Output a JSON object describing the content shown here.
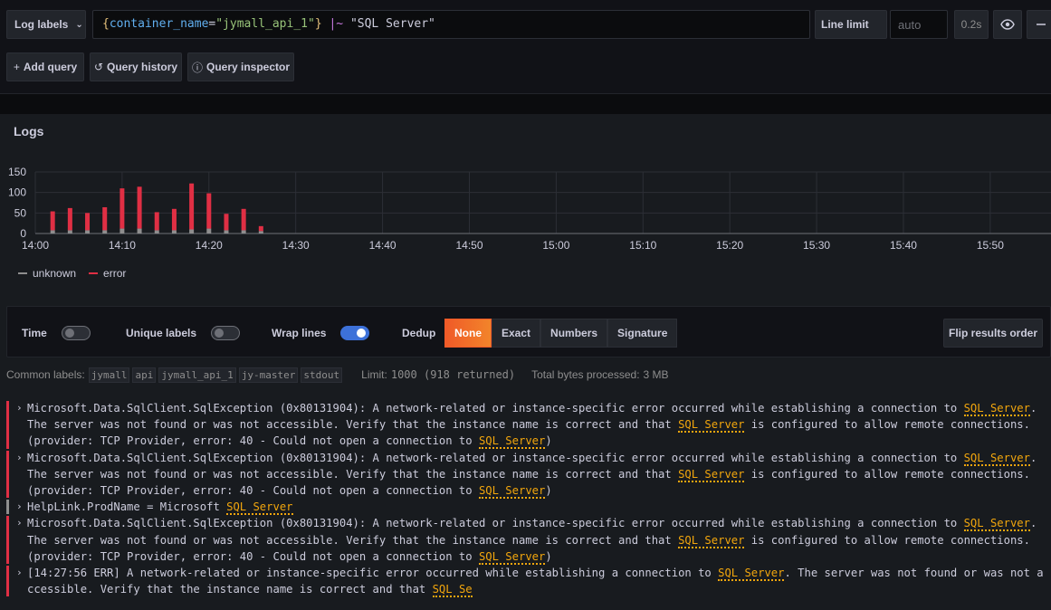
{
  "query_editor": {
    "labels_button": "Log labels",
    "query_parts": {
      "open_brace": "{",
      "key": "container_name",
      "equals": "=",
      "value": "\"jymall_api_1\"",
      "close_brace": "}",
      "pipe_op": " |~ ",
      "filter": "\"SQL Server\""
    },
    "line_limit_label": "Line limit",
    "line_limit_placeholder": "auto",
    "query_time": "0.2s"
  },
  "query_actions": {
    "add_query": "Add query",
    "query_history": "Query history",
    "query_inspector": "Query inspector"
  },
  "panel": {
    "title": "Logs"
  },
  "chart_data": {
    "type": "bar",
    "stacked": true,
    "x": [
      "14:02",
      "14:04",
      "14:06",
      "14:08",
      "14:10",
      "14:12",
      "14:14",
      "14:16",
      "14:18",
      "14:20",
      "14:22",
      "14:24",
      "14:26"
    ],
    "series": [
      {
        "name": "unknown",
        "color": "#8e8e8e",
        "values": [
          8,
          8,
          8,
          8,
          12,
          12,
          8,
          8,
          10,
          12,
          8,
          8,
          6
        ]
      },
      {
        "name": "error",
        "color": "#e02f44",
        "values": [
          46,
          54,
          42,
          56,
          98,
          102,
          44,
          52,
          112,
          86,
          40,
          52,
          12
        ]
      }
    ],
    "x_ticks": [
      "14:00",
      "14:10",
      "14:20",
      "14:30",
      "14:40",
      "14:50",
      "15:00",
      "15:10",
      "15:20",
      "15:30",
      "15:40",
      "15:50"
    ],
    "y_ticks": [
      "0",
      "50",
      "100",
      "150"
    ],
    "ylim": [
      0,
      150
    ],
    "xlim": [
      "14:00",
      "15:57"
    ],
    "grid": true,
    "legend": "bottom-left"
  },
  "legend": {
    "unknown": "unknown",
    "error": "error",
    "unknown_color": "#8e8e8e",
    "error_color": "#e02f44"
  },
  "options": {
    "time_label": "Time",
    "time_on": false,
    "unique_labels_label": "Unique labels",
    "unique_labels_on": false,
    "wrap_lines_label": "Wrap lines",
    "wrap_lines_on": true,
    "dedup_label": "Dedup",
    "dedup_options": [
      "None",
      "Exact",
      "Numbers",
      "Signature"
    ],
    "dedup_selected": "None",
    "flip_label": "Flip results order"
  },
  "meta": {
    "common_labels_label": "Common labels:",
    "common_labels": [
      "jymall",
      "api",
      "jymall_api_1",
      "jy-master",
      "stdout"
    ],
    "limit_label": "Limit:",
    "limit_value": "1000 (918 returned)",
    "bytes_label": "Total bytes processed:",
    "bytes_value": "3 MB"
  },
  "log_rows": [
    {
      "level": "error",
      "parts": [
        "Microsoft.Data.SqlClient.SqlException (0x80131904): A network-related or instance-specific error occurred while establishing a connection to ",
        "SQL Server",
        ". The server was not found or was not accessible. Verify that the instance name is correct and that ",
        "SQL Server",
        " is configured to allow remote connections. (provider: TCP Provider, error: 40 - Could not open a connection to ",
        "SQL Server",
        ")"
      ]
    },
    {
      "level": "error",
      "parts": [
        "Microsoft.Data.SqlClient.SqlException (0x80131904): A network-related or instance-specific error occurred while establishing a connection to ",
        "SQL Server",
        ". The server was not found or was not accessible. Verify that the instance name is correct and that ",
        "SQL Server",
        " is configured to allow remote connections. (provider: TCP Provider, error: 40 - Could not open a connection to ",
        "SQL Server",
        ")"
      ]
    },
    {
      "level": "unknown",
      "parts": [
        "HelpLink.ProdName = Microsoft ",
        "SQL Server"
      ]
    },
    {
      "level": "error",
      "parts": [
        "Microsoft.Data.SqlClient.SqlException (0x80131904): A network-related or instance-specific error occurred while establishing a connection to ",
        "SQL Server",
        ". The server was not found or was not accessible. Verify that the instance name is correct and that ",
        "SQL Server",
        " is configured to allow remote connections. (provider: TCP Provider, error: 40 - Could not open a connection to ",
        "SQL Server",
        ")"
      ]
    },
    {
      "level": "error",
      "parts": [
        "[14:27:56 ERR] A network-related or instance-specific error occurred while establishing a connection to ",
        "SQL Server",
        ". The server was not found or was not accessible. Verify that the instance name is correct and that ",
        "SQL Se"
      ]
    }
  ]
}
